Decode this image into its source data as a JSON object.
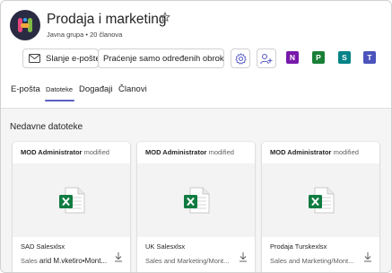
{
  "group": {
    "name": "Prodaja i marketing",
    "meta": "Javna grupa • 20 članova"
  },
  "actions": {
    "send_email": "Slanje e-pošte",
    "follow": "Praćenje samo određenih obroka"
  },
  "apps": [
    {
      "name": "OneNote",
      "letter": "N",
      "color": "#7719aa"
    },
    {
      "name": "Planner",
      "letter": "P",
      "color": "#1a7f37"
    },
    {
      "name": "SharePoint",
      "letter": "S",
      "color": "#038387"
    },
    {
      "name": "Teams",
      "letter": "T",
      "color": "#4b53bc"
    }
  ],
  "tabs": [
    {
      "label": "E-pošta",
      "active": false
    },
    {
      "label": "Datoteke",
      "active": true
    },
    {
      "label": "Događaji",
      "active": false
    },
    {
      "label": "Članovi",
      "active": false
    }
  ],
  "files": {
    "section_title": "Nedavne datoteke",
    "cards": [
      {
        "author": "MOD Administrator",
        "action": "modified",
        "filename": "SAD Salesxlsx",
        "location_prefix": "Sales",
        "location_extra": "arid M.vketiro•Mont...",
        "location": ""
      },
      {
        "author": "MOD Administrator",
        "action": "modified",
        "filename": "UK Salesxlsx",
        "location": "Sales and Marketing/Mont..."
      },
      {
        "author": "MOD Administrator",
        "action": "modified",
        "filename": "Prodaja Turskexlsx",
        "location": "Sales and Marketing/Mont..."
      }
    ]
  },
  "colors": {
    "accent": "#5b5fc7",
    "excel_green": "#107c41",
    "avatar_bg": "#2a2b43"
  }
}
